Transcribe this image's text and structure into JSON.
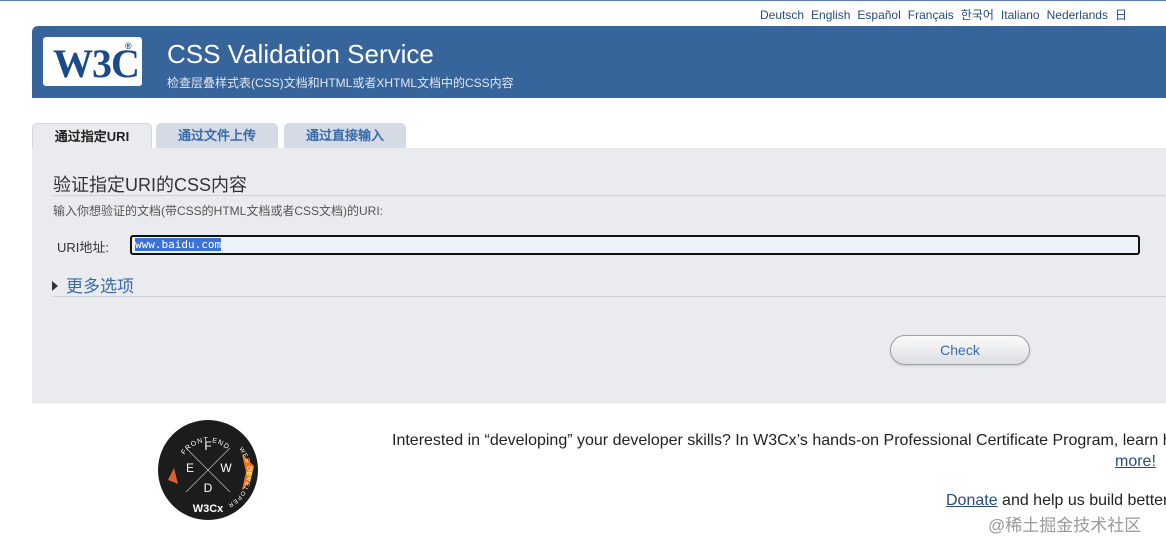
{
  "languages": [
    "Deutsch",
    "English",
    "Español",
    "Français",
    "한국어",
    "Italiano",
    "Nederlands",
    "日"
  ],
  "header": {
    "logo_text": "W3C",
    "logo_reg": "®",
    "title": "CSS Validation Service",
    "subtitle": "检查层叠样式表(CSS)文档和HTML或者XHTML文档中的CSS内容"
  },
  "tabs": [
    {
      "label": "通过指定URI",
      "active": true
    },
    {
      "label": "通过文件上传",
      "active": false
    },
    {
      "label": "通过直接输入",
      "active": false
    }
  ],
  "form": {
    "heading": "验证指定URI的CSS内容",
    "description": "输入你想验证的文档(带CSS的HTML文档或者CSS文档)的URI:",
    "uri_label": "URI地址:",
    "uri_value": "www.baidu.com",
    "more_options": "更多选项",
    "check_label": "Check"
  },
  "footer": {
    "badge_top": "FRONT END",
    "badge_side": "WEB DEVELOPER",
    "badge_letters": [
      "F",
      "E",
      "W",
      "D"
    ],
    "badge_brand": "W3Cx",
    "promo": "Interested in “developing” your developer skills? In W3Cx’s hands-on Professional Certificate Program, learn h",
    "more_link": "more!",
    "donate_link": "Donate",
    "donate_rest": " and help us build better",
    "watermark": "@稀土掘金技术社区"
  },
  "colors": {
    "banner": "#38649c",
    "link": "#284b85",
    "panel": "#e9ebee",
    "selection": "#3a72d8"
  }
}
